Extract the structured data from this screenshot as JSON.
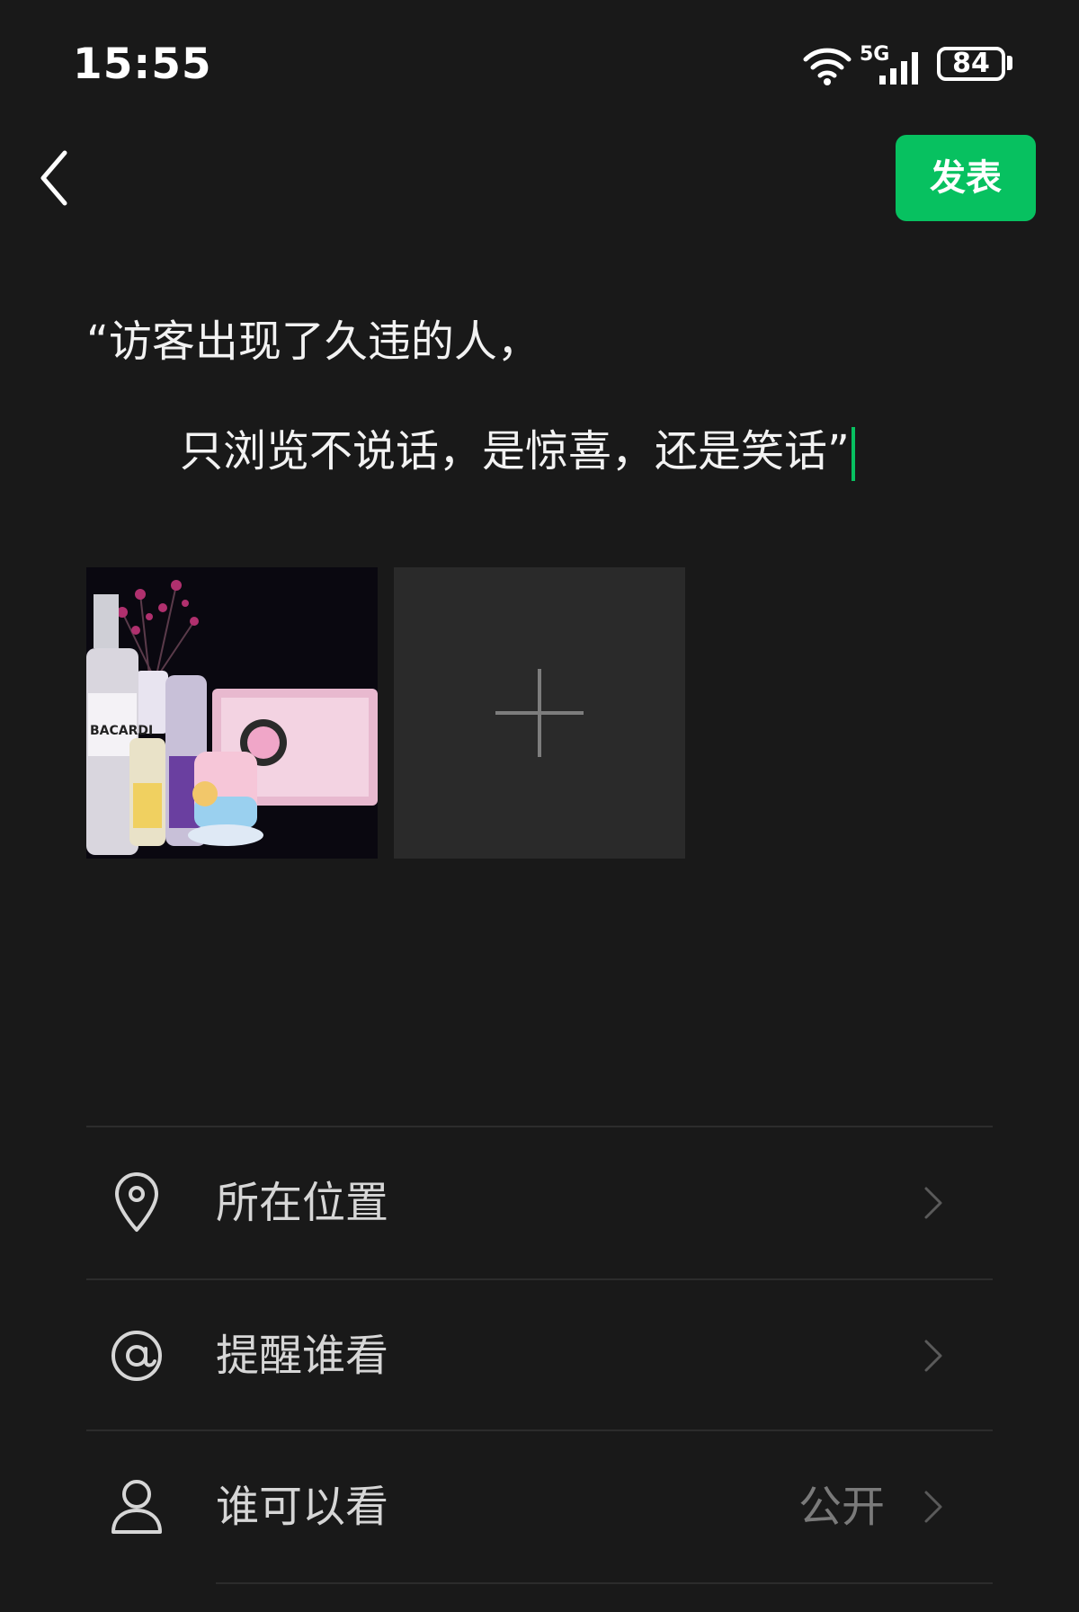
{
  "status_bar": {
    "time": "15:55",
    "network": "5G",
    "battery": "84",
    "icons": [
      "wifi-icon",
      "cellular-signal-icon",
      "battery-icon"
    ]
  },
  "header": {
    "back_icon": "chevron-left-icon",
    "publish_label": "发表",
    "accent_color": "#07c160"
  },
  "post": {
    "line1": "“访客出现了久违的人，",
    "line2": "只浏览不说话，是惊喜，还是笑话”"
  },
  "media": {
    "thumbnail_icon": "photo-thumbnail",
    "add_icon": "plus-icon",
    "image_text": "BACARDI"
  },
  "options": [
    {
      "icon": "location-pin-icon",
      "label": "所在位置",
      "value": ""
    },
    {
      "icon": "at-sign-icon",
      "label": "提醒谁看",
      "value": ""
    },
    {
      "icon": "person-icon",
      "label": "谁可以看",
      "value": "公开"
    }
  ]
}
